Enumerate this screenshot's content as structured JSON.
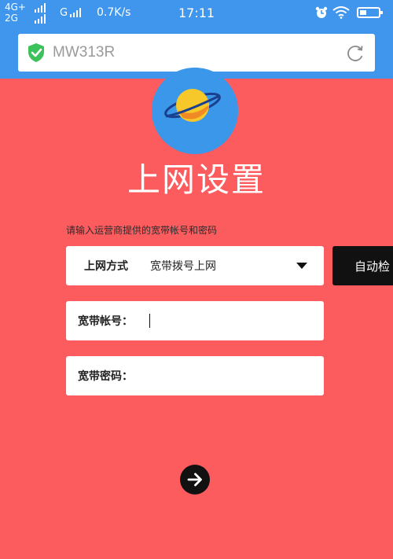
{
  "status_bar": {
    "net_top": "4G+",
    "net_bottom": "2G",
    "g_label": "G",
    "speed": "0.7K/s",
    "time": "17:11",
    "icons": [
      "signal-icon",
      "alarm-icon",
      "wifi-icon",
      "battery-icon"
    ]
  },
  "address_bar": {
    "url": "MW313R",
    "icons": [
      "shield-check-icon",
      "reload-icon"
    ]
  },
  "page": {
    "title": "上网设置",
    "hint": "请输入运营商提供的宽带帐号和密码"
  },
  "form": {
    "method_label": "上网方式",
    "method_value": "宽带拨号上网",
    "detect_button": "自动检",
    "account_label": "宽带帐号：",
    "account_value": "",
    "password_label": "宽带密码：",
    "password_value": ""
  },
  "colors": {
    "background": "#fd5c5f",
    "header": "#3f96ec",
    "shield": "#3cc15b",
    "button": "#111111"
  }
}
